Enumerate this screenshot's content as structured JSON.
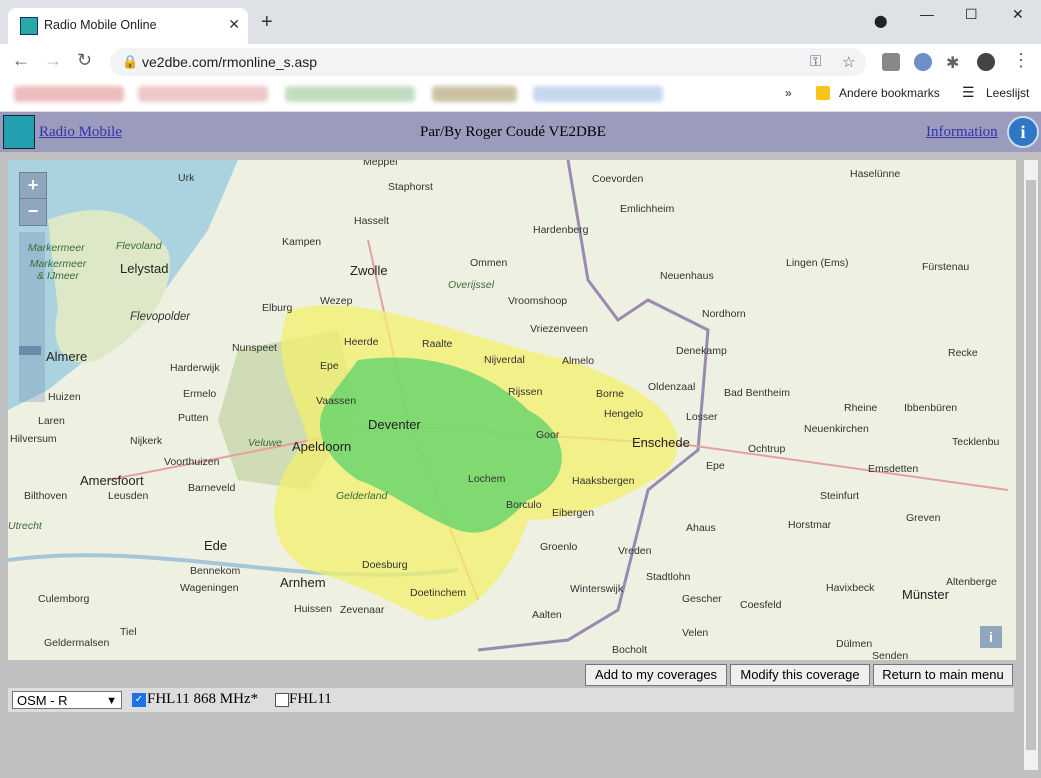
{
  "browser": {
    "tab_title": "Radio Mobile Online",
    "url": "ve2dbe.com/rmonline_s.asp",
    "bookmarks_more": "»",
    "other_bookmarks": "Andere bookmarks",
    "reading_list": "Leeslijst"
  },
  "header": {
    "app_name": "Radio Mobile",
    "byline": "Par/By Roger Coudé VE2DBE",
    "info_link": "Information"
  },
  "map": {
    "zoom_in": "+",
    "zoom_out": "−",
    "info_button": "i",
    "places": [
      {
        "name": "Meppel"
      },
      {
        "name": "Coevorden"
      },
      {
        "name": "Haselünne"
      },
      {
        "name": "Urk"
      },
      {
        "name": "Staphorst"
      },
      {
        "name": "Emlichheim"
      },
      {
        "name": "Hasselt"
      },
      {
        "name": "Hardenberg"
      },
      {
        "name": "Flevoland"
      },
      {
        "name": "Kampen"
      },
      {
        "name": "Markermeer"
      },
      {
        "name": "Markermeer & IJmeer"
      },
      {
        "name": "Lelystad"
      },
      {
        "name": "Zwolle"
      },
      {
        "name": "Ommen"
      },
      {
        "name": "Lingen (Ems)"
      },
      {
        "name": "Fürstenau"
      },
      {
        "name": "Neuenhaus"
      },
      {
        "name": "Overijssel"
      },
      {
        "name": "Wezep"
      },
      {
        "name": "Vroomshoop"
      },
      {
        "name": "Elburg"
      },
      {
        "name": "Flevopolder"
      },
      {
        "name": "Nordhorn"
      },
      {
        "name": "Vriezenveen"
      },
      {
        "name": "Heerde"
      },
      {
        "name": "Nunspeet"
      },
      {
        "name": "Raalte"
      },
      {
        "name": "Denekamp"
      },
      {
        "name": "Almere"
      },
      {
        "name": "Nijverdal"
      },
      {
        "name": "Almelo"
      },
      {
        "name": "Recke"
      },
      {
        "name": "Harderwijk"
      },
      {
        "name": "Epe"
      },
      {
        "name": "Oldenzaal"
      },
      {
        "name": "Rijssen"
      },
      {
        "name": "Borne"
      },
      {
        "name": "Bad Bentheim"
      },
      {
        "name": "Huizen"
      },
      {
        "name": "Ermelo"
      },
      {
        "name": "Vaassen"
      },
      {
        "name": "Hengelo"
      },
      {
        "name": "Rheine"
      },
      {
        "name": "Ibbenbüren"
      },
      {
        "name": "Laren"
      },
      {
        "name": "Putten"
      },
      {
        "name": "Losser"
      },
      {
        "name": "Deventer"
      },
      {
        "name": "Neuenkirchen"
      },
      {
        "name": "Hilversum"
      },
      {
        "name": "Nijkerk"
      },
      {
        "name": "Veluwe"
      },
      {
        "name": "Apeldoorn"
      },
      {
        "name": "Goor"
      },
      {
        "name": "Enschede"
      },
      {
        "name": "Tecklenbu"
      },
      {
        "name": "Voorthuizen"
      },
      {
        "name": "Ochtrup"
      },
      {
        "name": "Epe"
      },
      {
        "name": "Emsdetten"
      },
      {
        "name": "Lochem"
      },
      {
        "name": "Haaksbergen"
      },
      {
        "name": "Amersfoort"
      },
      {
        "name": "Barneveld"
      },
      {
        "name": "Bilthoven"
      },
      {
        "name": "Leusden"
      },
      {
        "name": "Gelderland"
      },
      {
        "name": "Steinfurt"
      },
      {
        "name": "Borculo"
      },
      {
        "name": "Eibergen"
      },
      {
        "name": "Ahaus"
      },
      {
        "name": "Utrecht"
      },
      {
        "name": "Horstmar"
      },
      {
        "name": "Greven"
      },
      {
        "name": "Ede"
      },
      {
        "name": "Groenlo"
      },
      {
        "name": "Vreden"
      },
      {
        "name": "Bennekom"
      },
      {
        "name": "Doesburg"
      },
      {
        "name": "Wageningen"
      },
      {
        "name": "Arnhem"
      },
      {
        "name": "Stadtlohn"
      },
      {
        "name": "Altenberge"
      },
      {
        "name": "Winterswijk"
      },
      {
        "name": "Havixbeck"
      },
      {
        "name": "Culemborg"
      },
      {
        "name": "Doetinchem"
      },
      {
        "name": "Gescher"
      },
      {
        "name": "Münster"
      },
      {
        "name": "Huissen"
      },
      {
        "name": "Zevenaar"
      },
      {
        "name": "Coesfeld"
      },
      {
        "name": "Aalten"
      },
      {
        "name": "Tiel"
      },
      {
        "name": "Velen"
      },
      {
        "name": "Geldermalsen"
      },
      {
        "name": "Bocholt"
      },
      {
        "name": "Dülmen"
      },
      {
        "name": "Senden"
      }
    ]
  },
  "actions": {
    "add": "Add to my coverages",
    "modify": "Modify this coverage",
    "return": "Return to main menu"
  },
  "controls": {
    "map_select_value": "OSM - R",
    "layer1_label": "FHL11 868 MHz*",
    "layer1_checked": true,
    "layer2_label": "FHL11",
    "layer2_checked": false
  }
}
